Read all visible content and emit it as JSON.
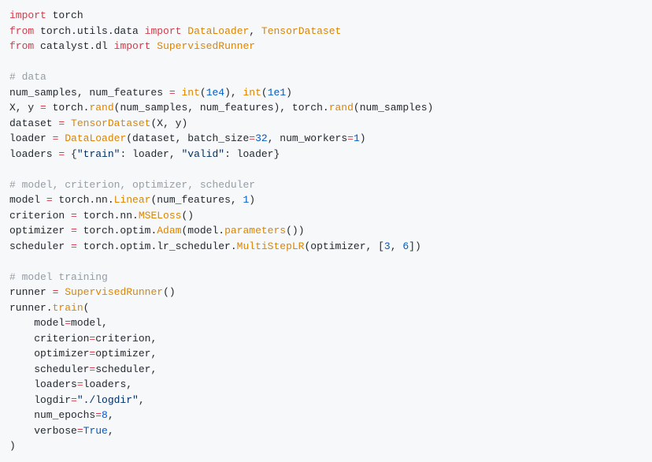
{
  "code": {
    "lines": [
      [
        [
          "kw",
          "import"
        ],
        [
          "txt",
          " torch"
        ]
      ],
      [
        [
          "kw",
          "from"
        ],
        [
          "txt",
          " torch.utils.data "
        ],
        [
          "kw",
          "import"
        ],
        [
          "txt",
          " "
        ],
        [
          "fn",
          "DataLoader"
        ],
        [
          "txt",
          ", "
        ],
        [
          "fn",
          "TensorDataset"
        ]
      ],
      [
        [
          "kw",
          "from"
        ],
        [
          "txt",
          " catalyst.dl "
        ],
        [
          "kw",
          "import"
        ],
        [
          "txt",
          " "
        ],
        [
          "fn",
          "SupervisedRunner"
        ]
      ],
      [],
      [
        [
          "com",
          "# data"
        ]
      ],
      [
        [
          "txt",
          "num_samples, num_features "
        ],
        [
          "kw",
          "="
        ],
        [
          "txt",
          " "
        ],
        [
          "fn",
          "int"
        ],
        [
          "txt",
          "("
        ],
        [
          "num",
          "1e4"
        ],
        [
          "txt",
          "), "
        ],
        [
          "fn",
          "int"
        ],
        [
          "txt",
          "("
        ],
        [
          "num",
          "1e1"
        ],
        [
          "txt",
          ")"
        ]
      ],
      [
        [
          "txt",
          "X, y "
        ],
        [
          "kw",
          "="
        ],
        [
          "txt",
          " torch."
        ],
        [
          "fn",
          "rand"
        ],
        [
          "txt",
          "(num_samples, num_features), torch."
        ],
        [
          "fn",
          "rand"
        ],
        [
          "txt",
          "(num_samples)"
        ]
      ],
      [
        [
          "txt",
          "dataset "
        ],
        [
          "kw",
          "="
        ],
        [
          "txt",
          " "
        ],
        [
          "fn",
          "TensorDataset"
        ],
        [
          "txt",
          "(X, y)"
        ]
      ],
      [
        [
          "txt",
          "loader "
        ],
        [
          "kw",
          "="
        ],
        [
          "txt",
          " "
        ],
        [
          "fn",
          "DataLoader"
        ],
        [
          "txt",
          "(dataset, batch_size"
        ],
        [
          "kw",
          "="
        ],
        [
          "num",
          "32"
        ],
        [
          "txt",
          ", num_workers"
        ],
        [
          "kw",
          "="
        ],
        [
          "num",
          "1"
        ],
        [
          "txt",
          ")"
        ]
      ],
      [
        [
          "txt",
          "loaders "
        ],
        [
          "kw",
          "="
        ],
        [
          "txt",
          " {"
        ],
        [
          "str",
          "\"train\""
        ],
        [
          "txt",
          ": loader, "
        ],
        [
          "str",
          "\"valid\""
        ],
        [
          "txt",
          ": loader}"
        ]
      ],
      [],
      [
        [
          "com",
          "# model, criterion, optimizer, scheduler"
        ]
      ],
      [
        [
          "txt",
          "model "
        ],
        [
          "kw",
          "="
        ],
        [
          "txt",
          " torch.nn."
        ],
        [
          "fn",
          "Linear"
        ],
        [
          "txt",
          "(num_features, "
        ],
        [
          "num",
          "1"
        ],
        [
          "txt",
          ")"
        ]
      ],
      [
        [
          "txt",
          "criterion "
        ],
        [
          "kw",
          "="
        ],
        [
          "txt",
          " torch.nn."
        ],
        [
          "fn",
          "MSELoss"
        ],
        [
          "txt",
          "()"
        ]
      ],
      [
        [
          "txt",
          "optimizer "
        ],
        [
          "kw",
          "="
        ],
        [
          "txt",
          " torch.optim."
        ],
        [
          "fn",
          "Adam"
        ],
        [
          "txt",
          "(model."
        ],
        [
          "fn",
          "parameters"
        ],
        [
          "txt",
          "())"
        ]
      ],
      [
        [
          "txt",
          "scheduler "
        ],
        [
          "kw",
          "="
        ],
        [
          "txt",
          " torch.optim.lr_scheduler."
        ],
        [
          "fn",
          "MultiStepLR"
        ],
        [
          "txt",
          "(optimizer, ["
        ],
        [
          "num",
          "3"
        ],
        [
          "txt",
          ", "
        ],
        [
          "num",
          "6"
        ],
        [
          "txt",
          "])"
        ]
      ],
      [],
      [
        [
          "com",
          "# model training"
        ]
      ],
      [
        [
          "txt",
          "runner "
        ],
        [
          "kw",
          "="
        ],
        [
          "txt",
          " "
        ],
        [
          "fn",
          "SupervisedRunner"
        ],
        [
          "txt",
          "()"
        ]
      ],
      [
        [
          "txt",
          "runner."
        ],
        [
          "fn",
          "train"
        ],
        [
          "txt",
          "("
        ]
      ],
      [
        [
          "txt",
          "    model"
        ],
        [
          "kw",
          "="
        ],
        [
          "txt",
          "model,"
        ]
      ],
      [
        [
          "txt",
          "    criterion"
        ],
        [
          "kw",
          "="
        ],
        [
          "txt",
          "criterion,"
        ]
      ],
      [
        [
          "txt",
          "    optimizer"
        ],
        [
          "kw",
          "="
        ],
        [
          "txt",
          "optimizer,"
        ]
      ],
      [
        [
          "txt",
          "    scheduler"
        ],
        [
          "kw",
          "="
        ],
        [
          "txt",
          "scheduler,"
        ]
      ],
      [
        [
          "txt",
          "    loaders"
        ],
        [
          "kw",
          "="
        ],
        [
          "txt",
          "loaders,"
        ]
      ],
      [
        [
          "txt",
          "    logdir"
        ],
        [
          "kw",
          "="
        ],
        [
          "str",
          "\"./logdir\""
        ],
        [
          "txt",
          ","
        ]
      ],
      [
        [
          "txt",
          "    num_epochs"
        ],
        [
          "kw",
          "="
        ],
        [
          "num",
          "8"
        ],
        [
          "txt",
          ","
        ]
      ],
      [
        [
          "txt",
          "    verbose"
        ],
        [
          "kw",
          "="
        ],
        [
          "num",
          "True"
        ],
        [
          "txt",
          ","
        ]
      ],
      [
        [
          "txt",
          ")"
        ]
      ]
    ]
  }
}
